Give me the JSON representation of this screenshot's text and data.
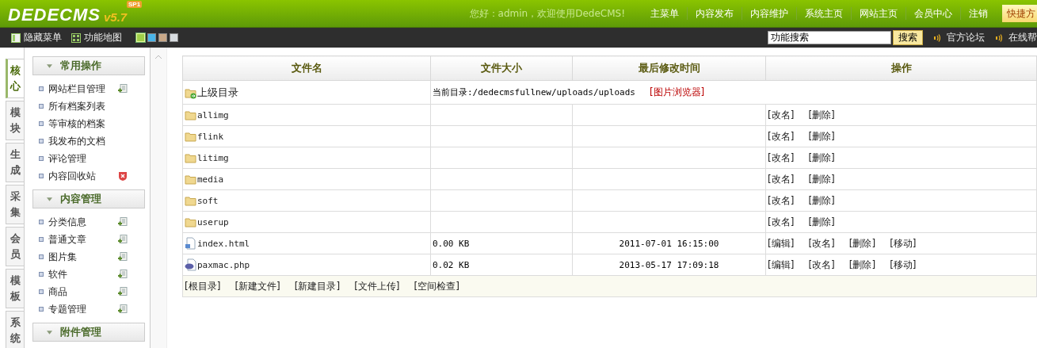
{
  "header": {
    "logo": "DEDECMS",
    "version": "v5.7",
    "badge": "SP1",
    "greeting": "您好：admin，欢迎使用DedeCMS!",
    "nav": [
      "主菜单",
      "内容发布",
      "内容维护",
      "系统主页",
      "网站主页",
      "会员中心",
      "注销"
    ],
    "shortcut": "快捷方"
  },
  "toolbar": {
    "left": [
      {
        "kind": "hide",
        "label": "隐藏菜单"
      },
      {
        "kind": "map",
        "label": "功能地图"
      }
    ],
    "skins": [
      {
        "color": "#9fd04a",
        "selected": true
      },
      {
        "color": "#4ab4e8",
        "selected": false
      },
      {
        "color": "#c8a888",
        "selected": false
      },
      {
        "color": "#d8dce0",
        "selected": false
      }
    ],
    "search": {
      "value": "功能搜索",
      "button": "搜索"
    },
    "links": [
      "官方论坛",
      "在线帮"
    ]
  },
  "side_tabs": [
    {
      "label": "核心",
      "selected": true
    },
    {
      "label": "模块",
      "selected": false
    },
    {
      "label": "生成",
      "selected": false
    },
    {
      "label": "采集",
      "selected": false
    },
    {
      "label": "会员",
      "selected": false
    },
    {
      "label": "模板",
      "selected": false
    },
    {
      "label": "系统",
      "selected": false
    }
  ],
  "menu_groups": [
    {
      "title": "常用操作",
      "items": [
        {
          "label": "网站栏目管理",
          "kind": "add"
        },
        {
          "label": "所有档案列表"
        },
        {
          "label": "等审核的档案"
        },
        {
          "label": "我发布的文档"
        },
        {
          "label": "评论管理"
        },
        {
          "label": "内容回收站",
          "kind": "delete"
        }
      ]
    },
    {
      "title": "内容管理",
      "items": [
        {
          "label": "分类信息",
          "kind": "add"
        },
        {
          "label": "普通文章",
          "kind": "add"
        },
        {
          "label": "图片集",
          "kind": "add"
        },
        {
          "label": "软件",
          "kind": "add"
        },
        {
          "label": "商品",
          "kind": "add"
        },
        {
          "label": "专题管理",
          "kind": "add"
        }
      ]
    },
    {
      "title": "附件管理"
    }
  ],
  "table": {
    "columns": [
      "文件名",
      "文件大小",
      "最后修改时间",
      "操作"
    ],
    "parent_row": {
      "name": "上级目录",
      "current_dir": "当前目录:/dedecmsfullnew/uploads/uploads",
      "browser_link": "[图片浏览器]"
    },
    "rows": [
      {
        "kind": "folder",
        "name": "allimg",
        "size": "",
        "modified": "",
        "actions": [
          "[改名]",
          "[删除]"
        ]
      },
      {
        "kind": "folder",
        "name": "flink",
        "size": "",
        "modified": "",
        "actions": [
          "[改名]",
          "[删除]"
        ]
      },
      {
        "kind": "folder",
        "name": "litimg",
        "size": "",
        "modified": "",
        "actions": [
          "[改名]",
          "[删除]"
        ]
      },
      {
        "kind": "folder",
        "name": "media",
        "size": "",
        "modified": "",
        "actions": [
          "[改名]",
          "[删除]"
        ]
      },
      {
        "kind": "folder",
        "name": "soft",
        "size": "",
        "modified": "",
        "actions": [
          "[改名]",
          "[删除]"
        ]
      },
      {
        "kind": "folder",
        "name": "userup",
        "size": "",
        "modified": "",
        "actions": [
          "[改名]",
          "[删除]"
        ]
      },
      {
        "kind": "html",
        "name": "index.html",
        "size": "0.00 KB",
        "modified": "2011-07-01 16:15:00",
        "actions": [
          "[编辑]",
          "[改名]",
          "[删除]",
          "[移动]"
        ]
      },
      {
        "kind": "php",
        "name": "paxmac.php",
        "size": "0.02 KB",
        "modified": "2013-05-17 17:09:18",
        "actions": [
          "[编辑]",
          "[改名]",
          "[删除]",
          "[移动]"
        ]
      }
    ],
    "footer_links": [
      "[根目录]",
      "[新建文件]",
      "[新建目录]",
      "[文件上传]",
      "[空间检查]"
    ]
  }
}
